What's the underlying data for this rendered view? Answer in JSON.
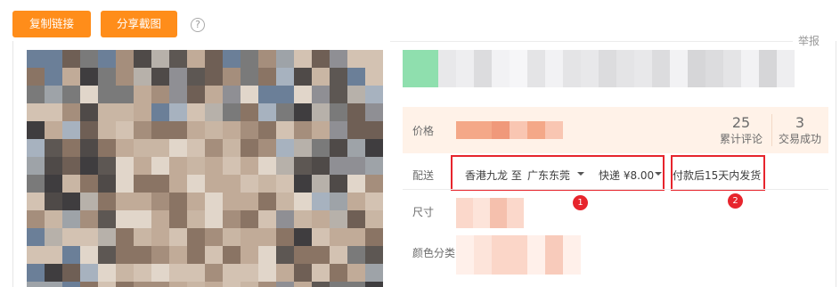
{
  "toolbar": {
    "copy_link_label": "复制链接",
    "share_screenshot_label": "分享截图",
    "help_icon": "?"
  },
  "report_label": "举报",
  "product": {
    "price_label": "价格",
    "stats": [
      {
        "value": "25",
        "label": "累计评论"
      },
      {
        "value": "3",
        "label": "交易成功"
      }
    ],
    "delivery": {
      "label": "配送",
      "from": "香港九龙 至",
      "to": "广东东莞",
      "shipping": "快递 ¥8.00",
      "dispatch_note": "付款后15天内发货",
      "annotation_1": "1",
      "annotation_2": "2"
    },
    "size_label": "尺寸",
    "color_label": "颜色分类"
  },
  "colors": {
    "accent": "#ff8d1a",
    "price_bg": "#fff2e8",
    "annotation_red": "#e7252d"
  }
}
